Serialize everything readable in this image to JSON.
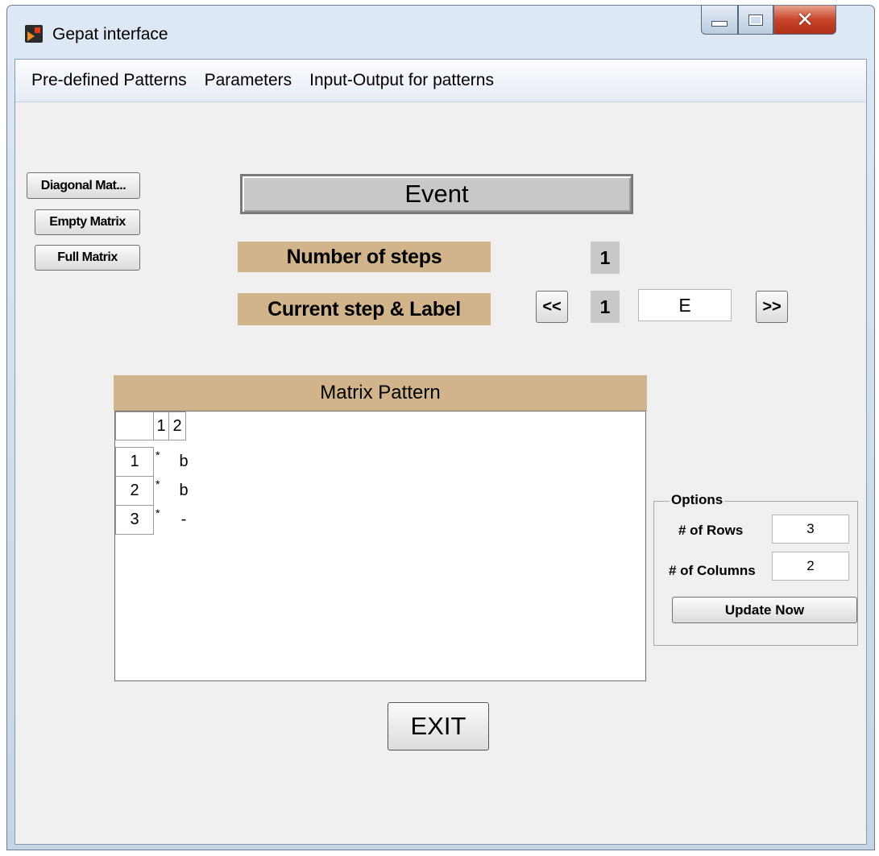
{
  "window": {
    "title": "Gepat interface"
  },
  "menu": {
    "items": [
      "Pre-defined Patterns",
      "Parameters",
      "Input-Output for patterns"
    ]
  },
  "pattern_buttons": {
    "diagonal": "Diagonal Mat...",
    "empty": "Empty Matrix",
    "full": "Full Matrix"
  },
  "event": {
    "title": "Event"
  },
  "steps": {
    "number_label": "Number of steps",
    "number_value": "1",
    "current_label": "Current step & Label",
    "prev_button": "<<",
    "current_value": "1",
    "label_value": "E",
    "next_button": ">>"
  },
  "matrix": {
    "title": "Matrix Pattern",
    "column_headers": [
      "1",
      "2"
    ],
    "rows": [
      {
        "header": "1",
        "marker": "*",
        "value": "b"
      },
      {
        "header": "2",
        "marker": "*",
        "value": "b"
      },
      {
        "header": "3",
        "marker": "*",
        "value": "-"
      }
    ]
  },
  "options": {
    "legend": "Options",
    "rows_label": "# of Rows",
    "rows_value": "3",
    "columns_label": "# of Columns",
    "columns_value": "2",
    "update_button": "Update Now"
  },
  "exit_button": "EXIT",
  "colors": {
    "label_tan": "#d2b48c",
    "value_gray": "#c8c8c8",
    "close_red": "#c8442b"
  }
}
